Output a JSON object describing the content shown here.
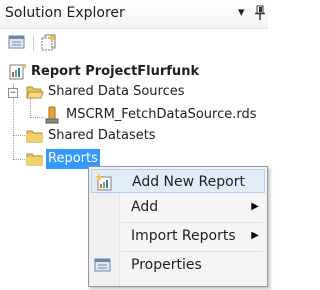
{
  "window": {
    "title": "Solution Explorer",
    "pin_glyph": "▾",
    "pin_icon": "pin-icon"
  },
  "toolbar": {
    "buttons": [
      {
        "name": "properties-toolbar-button",
        "icon": "properties-icon"
      },
      {
        "name": "show-all-files-toolbar-button",
        "icon": "show-all-files-icon"
      }
    ]
  },
  "tree": {
    "project": {
      "label": "Report ProjectFlurfunk",
      "icon": "report-project-icon"
    },
    "shared_data_sources": {
      "label": "Shared Data Sources",
      "icon": "folder-open-icon",
      "expander": "−"
    },
    "data_source": {
      "label": "MSCRM_FetchDataSource.rds",
      "icon": "data-source-icon"
    },
    "shared_datasets": {
      "label": "Shared Datasets",
      "icon": "folder-icon"
    },
    "reports": {
      "label": "Reports",
      "icon": "folder-icon",
      "selected": true
    }
  },
  "context_menu": {
    "items": [
      {
        "label": "Add New Report",
        "icon": "add-new-report-icon",
        "submenu": false,
        "highlighted": true
      },
      {
        "label": "Add",
        "icon": "",
        "submenu": true,
        "highlighted": false
      },
      {
        "label": "Import Reports",
        "icon": "",
        "submenu": true,
        "highlighted": false
      },
      {
        "label": "Properties",
        "icon": "properties-icon",
        "submenu": false,
        "highlighted": false
      }
    ],
    "submenu_arrow": "▶"
  },
  "colors": {
    "selection": "#3399ff",
    "menu_hover": "#e1ecf9",
    "folder": "#e8c15a"
  }
}
